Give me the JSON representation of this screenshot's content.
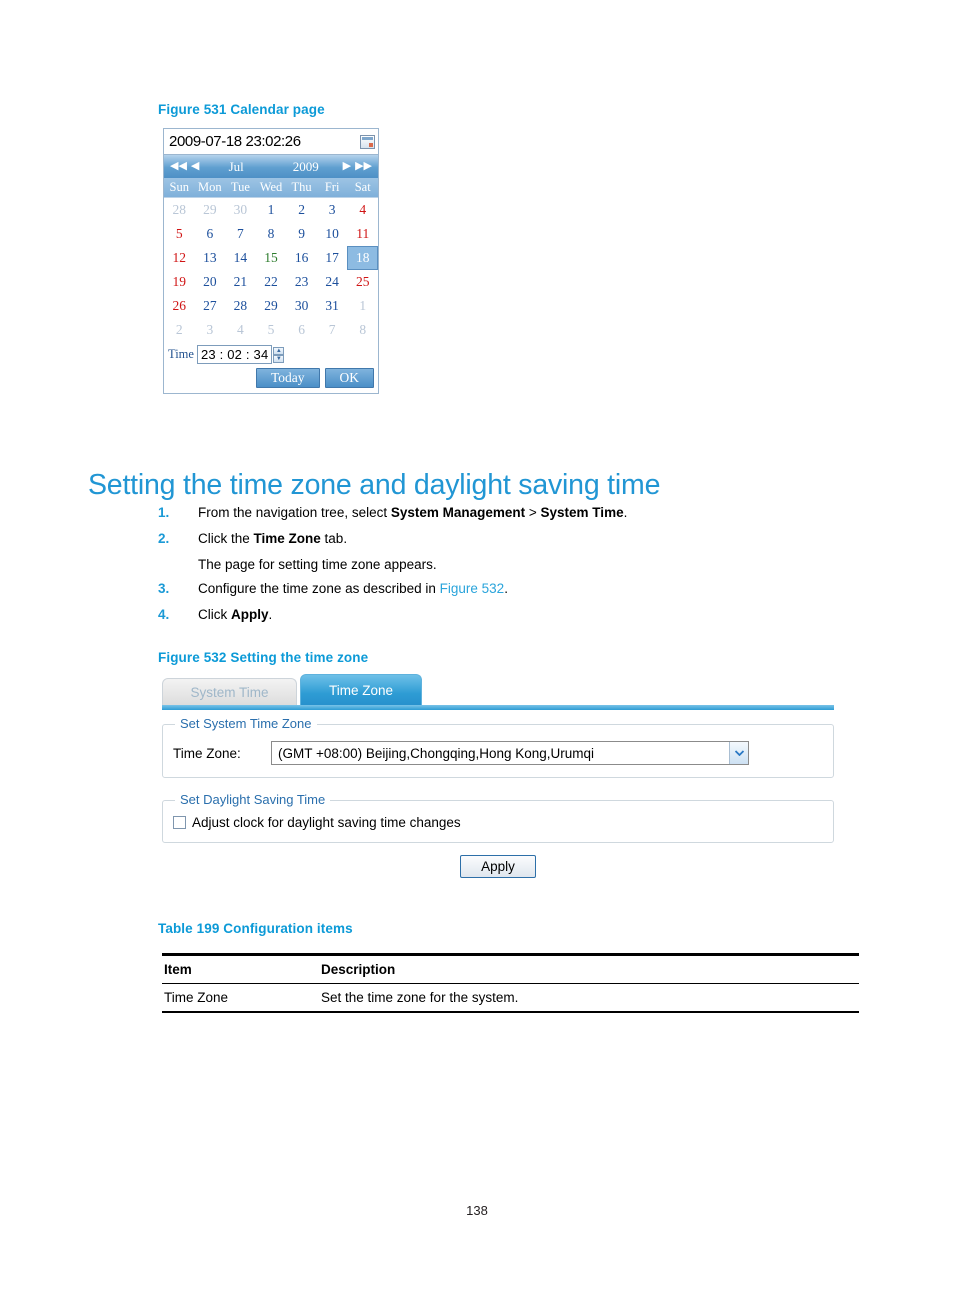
{
  "accent_color": "#0c9ad7",
  "figure531": {
    "caption": "Figure 531 Calendar page",
    "calendar": {
      "datetime_value": "2009-07-18  23:02:26",
      "icon": "calendar-icon",
      "nav": {
        "prev_year": "◀◀",
        "prev_month": "◀",
        "month": "Jul",
        "year": "2009",
        "next_month": "▶",
        "next_year": "▶▶"
      },
      "weekdays": [
        "Sun",
        "Mon",
        "Tue",
        "Wed",
        "Thu",
        "Fri",
        "Sat"
      ],
      "weeks": [
        [
          {
            "d": "28",
            "s": "other"
          },
          {
            "d": "29",
            "s": "other"
          },
          {
            "d": "30",
            "s": "other"
          },
          {
            "d": "1",
            "s": "day"
          },
          {
            "d": "2",
            "s": "day"
          },
          {
            "d": "3",
            "s": "day"
          },
          {
            "d": "4",
            "s": "wk-end"
          }
        ],
        [
          {
            "d": "5",
            "s": "wk-end"
          },
          {
            "d": "6",
            "s": "day"
          },
          {
            "d": "7",
            "s": "day"
          },
          {
            "d": "8",
            "s": "day"
          },
          {
            "d": "9",
            "s": "day"
          },
          {
            "d": "10",
            "s": "day"
          },
          {
            "d": "11",
            "s": "wk-end"
          }
        ],
        [
          {
            "d": "12",
            "s": "wk-end"
          },
          {
            "d": "13",
            "s": "day"
          },
          {
            "d": "14",
            "s": "day"
          },
          {
            "d": "15",
            "s": "today"
          },
          {
            "d": "16",
            "s": "day"
          },
          {
            "d": "17",
            "s": "day"
          },
          {
            "d": "18",
            "s": "sel"
          }
        ],
        [
          {
            "d": "19",
            "s": "wk-end"
          },
          {
            "d": "20",
            "s": "day"
          },
          {
            "d": "21",
            "s": "day"
          },
          {
            "d": "22",
            "s": "day"
          },
          {
            "d": "23",
            "s": "day"
          },
          {
            "d": "24",
            "s": "day"
          },
          {
            "d": "25",
            "s": "wk-end"
          }
        ],
        [
          {
            "d": "26",
            "s": "wk-end"
          },
          {
            "d": "27",
            "s": "day"
          },
          {
            "d": "28",
            "s": "day"
          },
          {
            "d": "29",
            "s": "day"
          },
          {
            "d": "30",
            "s": "day"
          },
          {
            "d": "31",
            "s": "day"
          },
          {
            "d": "1",
            "s": "other"
          }
        ],
        [
          {
            "d": "2",
            "s": "other"
          },
          {
            "d": "3",
            "s": "other"
          },
          {
            "d": "4",
            "s": "other"
          },
          {
            "d": "5",
            "s": "other"
          },
          {
            "d": "6",
            "s": "other"
          },
          {
            "d": "7",
            "s": "other"
          },
          {
            "d": "8",
            "s": "other"
          }
        ]
      ],
      "time_label": "Time",
      "time_value": "23 : 02 : 34",
      "today_button": "Today",
      "ok_button": "OK"
    }
  },
  "heading": "Setting the time zone and daylight saving time",
  "steps": [
    {
      "num": "1.",
      "parts": [
        {
          "t": "From the navigation tree, select ",
          "b": false
        },
        {
          "t": "System Management",
          "b": true
        },
        {
          "t": " > ",
          "b": false
        },
        {
          "t": "System Time",
          "b": true
        },
        {
          "t": ".",
          "b": false
        }
      ]
    },
    {
      "num": "2.",
      "parts": [
        {
          "t": "Click the ",
          "b": false
        },
        {
          "t": "Time Zone",
          "b": true
        },
        {
          "t": " tab.",
          "b": false
        }
      ]
    },
    {
      "num": "3.",
      "parts": [
        {
          "t": "Configure the time zone as described in ",
          "b": false
        },
        {
          "t": "Figure 532",
          "b": false,
          "link": true
        },
        {
          "t": ".",
          "b": false
        }
      ]
    },
    {
      "num": "4.",
      "parts": [
        {
          "t": "Click ",
          "b": false
        },
        {
          "t": "Apply",
          "b": true
        },
        {
          "t": ".",
          "b": false
        }
      ]
    }
  ],
  "step2_note": "The page for setting time zone appears.",
  "figure532": {
    "caption": "Figure 532 Setting the time zone",
    "tabs": [
      {
        "label": "System Time",
        "active": false
      },
      {
        "label": "Time Zone",
        "active": true
      }
    ],
    "timezone_fieldset": {
      "legend": "Set System Time Zone",
      "field_label": "Time Zone:",
      "selected_value": "(GMT +08:00) Beijing,Chongqing,Hong Kong,Urumqi"
    },
    "dst_fieldset": {
      "legend": "Set Daylight Saving Time",
      "checkbox_label": "Adjust clock for daylight saving time changes",
      "checkbox_checked": false
    },
    "apply_button": "Apply"
  },
  "table199": {
    "caption": "Table 199 Configuration items",
    "headers": [
      "Item",
      "Description"
    ],
    "rows": [
      [
        "Time Zone",
        "Set the time zone for the system."
      ]
    ]
  },
  "page_number": "138"
}
